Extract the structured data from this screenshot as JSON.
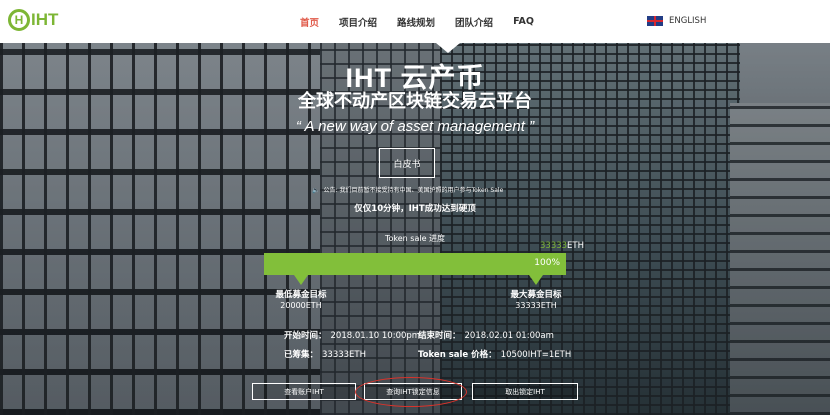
{
  "logo": {
    "mark": "H",
    "text": "IHT"
  },
  "nav": {
    "items": [
      {
        "label": "首页",
        "active": true
      },
      {
        "label": "项目介绍"
      },
      {
        "label": "路线规划"
      },
      {
        "label": "团队介绍"
      },
      {
        "label": "FAQ"
      }
    ],
    "language": {
      "label": "ENGLISH",
      "icon": "uk-flag-icon"
    }
  },
  "hero": {
    "title": "IHT 云产币",
    "subtitle": "全球不动产区块链交易云平台",
    "tagline": "“ A new way of asset management ”",
    "whitepaper_button": "白皮书",
    "notice_prefix": "公告:",
    "notice_text": "我们目前暂不接受持有中国、美国护照的用户参与Token Sale",
    "done_text": "仅仅10分钟，IHT成功达到硬顶"
  },
  "sale": {
    "label": "Token sale 进度",
    "raised_amount": "33333",
    "raised_unit": "ETH",
    "progress_percent": 100,
    "progress_text": "100%",
    "soft_cap": {
      "label": "最低募金目标",
      "value": "20000ETH"
    },
    "hard_cap": {
      "label": "最大募金目标",
      "value": "33333ETH"
    },
    "start": {
      "label": "开始时间：",
      "value": "2018.01.10 10:00pm"
    },
    "end": {
      "label": "结束时间：",
      "value": "2018.02.01 01:00am"
    },
    "raised": {
      "label": "已筹集：",
      "value": "33333ETH"
    },
    "price": {
      "label": "Token sale 价格：",
      "value": "10500IHT=1ETH"
    }
  },
  "actions": {
    "view_account": "查看账户IHT",
    "query_lock": "查询IHT锁定信息",
    "unlock": "取出锁定IHT"
  },
  "colors": {
    "brand": "#7db635",
    "active_nav": "#e05a4a",
    "highlight": "#d9332b"
  }
}
